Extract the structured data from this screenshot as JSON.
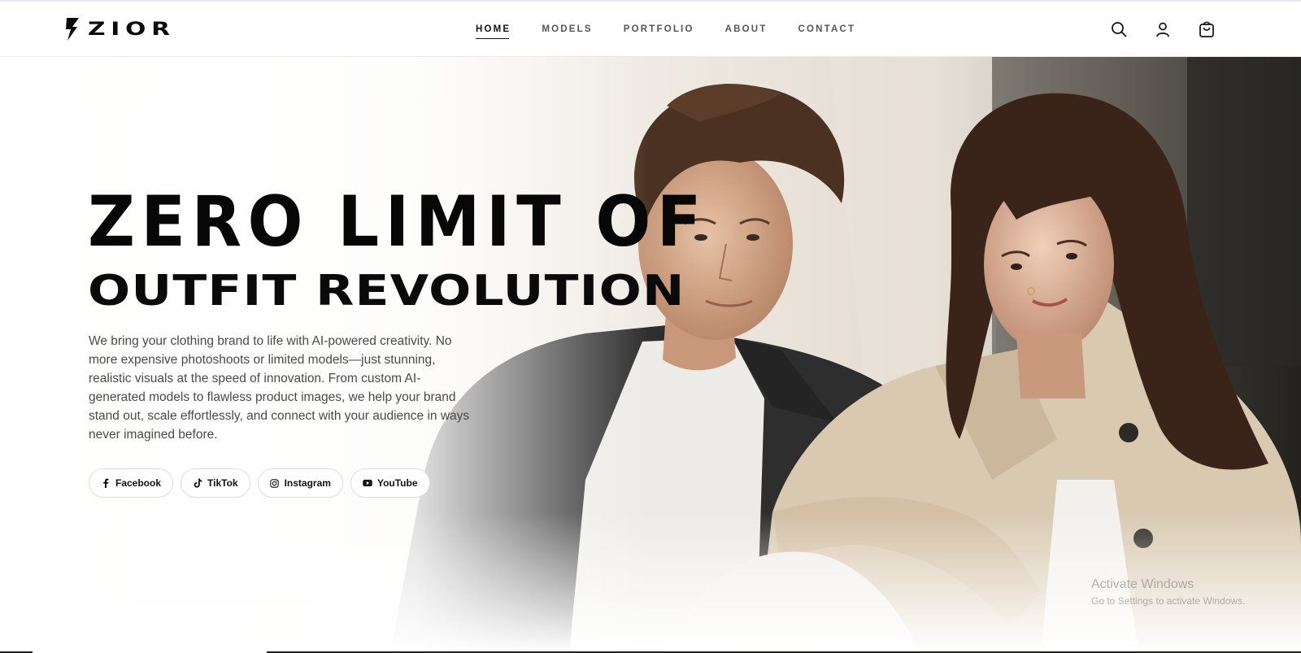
{
  "brand": {
    "name": "ZIOR"
  },
  "nav": {
    "items": [
      {
        "label": "HOME",
        "active": true
      },
      {
        "label": "MODELS",
        "active": false
      },
      {
        "label": "PORTFOLIO",
        "active": false
      },
      {
        "label": "ABOUT",
        "active": false
      },
      {
        "label": "CONTACT",
        "active": false
      }
    ]
  },
  "header_icons": [
    "search-icon",
    "user-icon",
    "shopping-bag-icon"
  ],
  "hero": {
    "title_line1": "ZERO LIMIT OF",
    "title_line2": "OUTFIT REVOLUTION",
    "description": "We bring your clothing brand to life with AI-powered creativity. No more expensive photoshoots or limited models—just stunning, realistic visuals at the speed of innovation. From custom AI-generated models to flawless product images, we help your brand stand out, scale effortlessly, and connect with your audience in ways never imagined before.",
    "socials": [
      {
        "label": "Facebook",
        "icon": "facebook-icon"
      },
      {
        "label": "TikTok",
        "icon": "tiktok-icon"
      },
      {
        "label": "Instagram",
        "icon": "instagram-icon"
      },
      {
        "label": "YouTube",
        "icon": "youtube-icon"
      }
    ]
  },
  "watermark": {
    "title": "Activate Windows",
    "subtitle": "Go to Settings to activate Windows."
  },
  "colors": {
    "text": "#111111",
    "nav_inactive": "#555555",
    "coat": "#d9c9b1",
    "jacket": "#2e2e2e"
  }
}
